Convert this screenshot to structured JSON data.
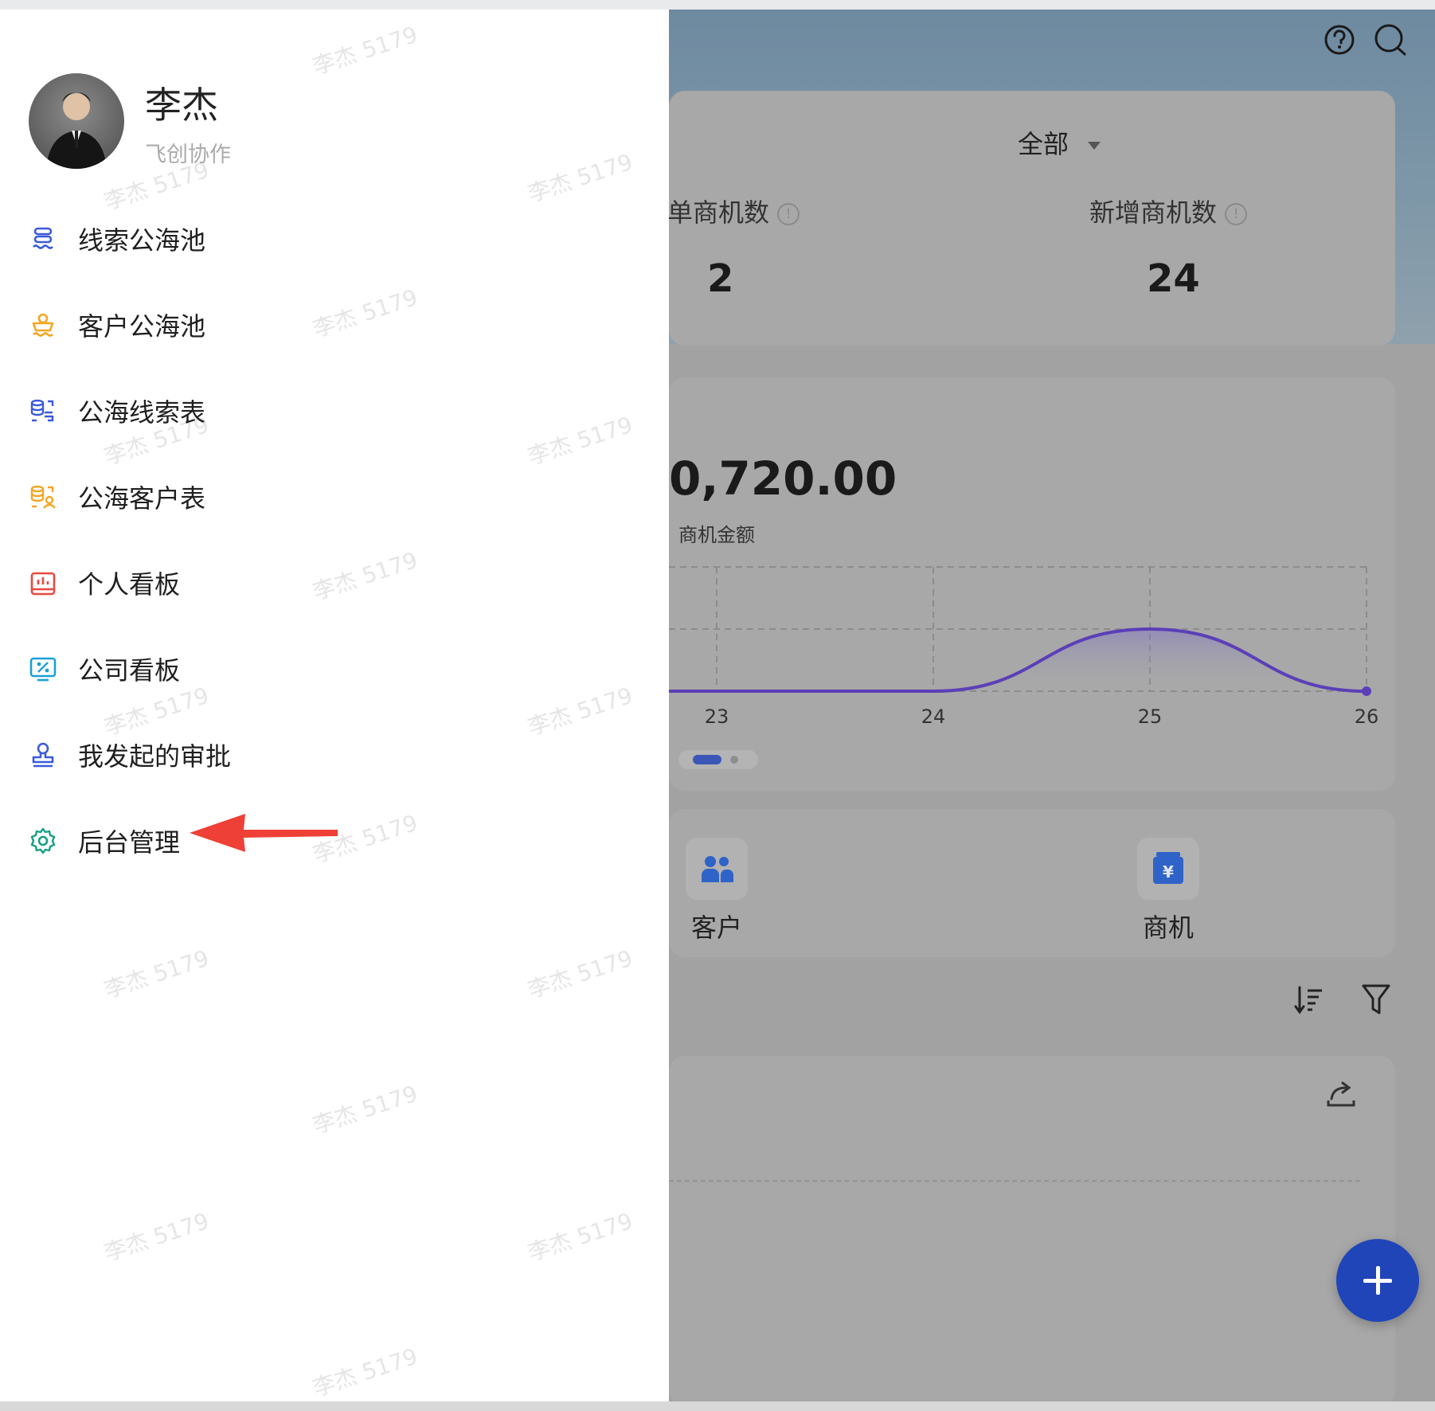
{
  "drawer": {
    "user": {
      "name": "李杰",
      "org": "飞创协作"
    },
    "menu": [
      {
        "label": "线索公海池",
        "icon": "clue-pool-icon",
        "color": "#3b5bdb"
      },
      {
        "label": "客户公海池",
        "icon": "customer-pool-icon",
        "color": "#f5a623"
      },
      {
        "label": "公海线索表",
        "icon": "clue-table-icon",
        "color": "#3b5bdb"
      },
      {
        "label": "公海客户表",
        "icon": "customer-table-icon",
        "color": "#f5a623"
      },
      {
        "label": "个人看板",
        "icon": "personal-dashboard-icon",
        "color": "#e8483f"
      },
      {
        "label": "公司看板",
        "icon": "company-dashboard-icon",
        "color": "#1aa0d8"
      },
      {
        "label": "我发起的审批",
        "icon": "approval-stamp-icon",
        "color": "#3b5bdb"
      },
      {
        "label": "后台管理",
        "icon": "gear-icon",
        "color": "#16a085"
      }
    ],
    "watermark": "李杰 5179"
  },
  "background": {
    "filter": "全部",
    "stats": [
      {
        "label": "单商机数",
        "value": "2"
      },
      {
        "label": "新增商机数",
        "value": "24"
      }
    ],
    "amount": "0,720.00",
    "amount_label": "商机金额",
    "quick": [
      {
        "label": "客户"
      },
      {
        "label": "商机"
      }
    ]
  },
  "chart_data": {
    "type": "area",
    "x": [
      "23",
      "24",
      "25",
      "26"
    ],
    "values": [
      0,
      0,
      1,
      0
    ],
    "series": [
      {
        "values": [
          0,
          0,
          1,
          0
        ]
      }
    ],
    "ylim": [
      0,
      2
    ],
    "grid": true,
    "title": "",
    "xlabel": "",
    "ylabel": "",
    "color": "#5b3fb8"
  },
  "colors": {
    "fab": "#1f45b9",
    "arrow": "#ee4036"
  }
}
